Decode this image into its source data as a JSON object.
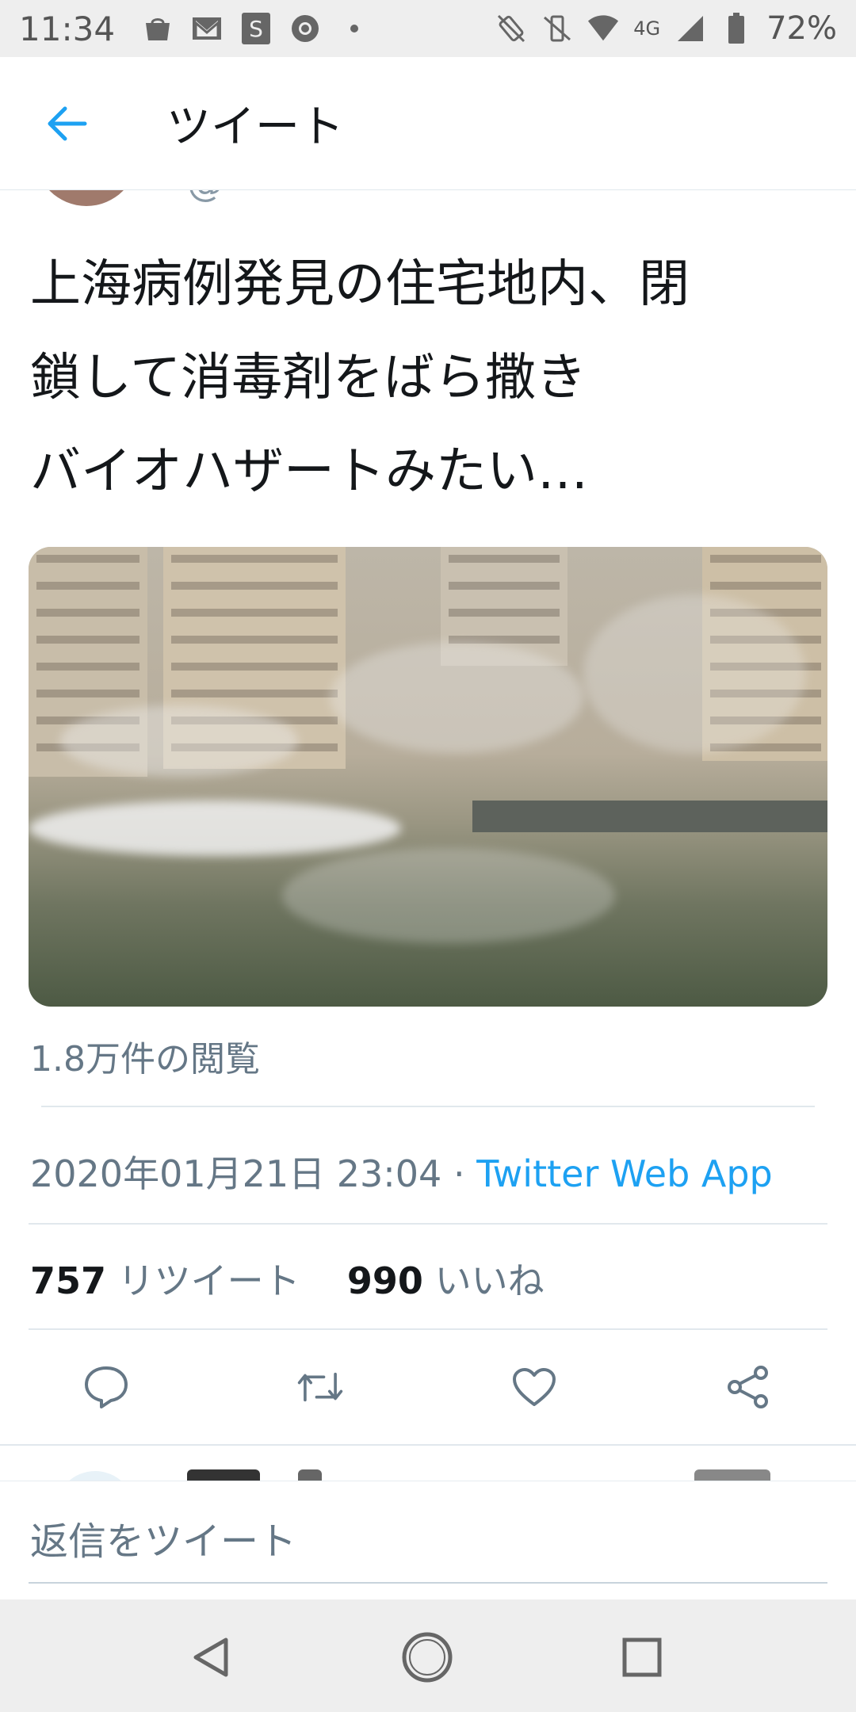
{
  "status_bar": {
    "time": "11:34",
    "network": "4G",
    "battery": "72%",
    "left_icons": [
      "market-icon",
      "gmail-icon",
      "s-app-icon",
      "chrome-icon",
      "more-dot-icon"
    ],
    "right_icons": [
      "vibrate-icon",
      "mute-icon",
      "wifi-icon",
      "signal-icon",
      "battery-icon"
    ]
  },
  "header": {
    "title": "ツイート"
  },
  "tweet": {
    "text_lines": [
      "上海病例発見の住宅地内、閉",
      "鎖して消毒剤をばら撒き",
      "バイオハザートみたい…"
    ],
    "views": "1.8万件の閲覧",
    "timestamp": "2020年01月21日 23:04 · ",
    "source": "Twitter Web App",
    "retweet_count": "757",
    "retweet_label": "リツイート",
    "like_count": "990",
    "like_label": "いいね"
  },
  "actions": [
    "reply-icon",
    "retweet-icon",
    "like-icon",
    "share-icon"
  ],
  "reply": {
    "placeholder": "返信をツイート"
  },
  "colors": {
    "accent": "#1da1f2",
    "secondary_text": "#657786",
    "primary_text": "#14171a"
  }
}
